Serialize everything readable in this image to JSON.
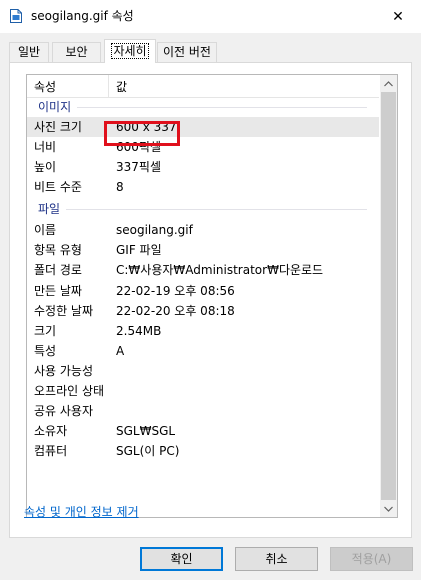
{
  "window": {
    "title": "seogilang.gif 속성",
    "close_glyph": "✕"
  },
  "tabs": [
    {
      "label": "일반",
      "active": false
    },
    {
      "label": "보안",
      "active": false
    },
    {
      "label": "자세히",
      "active": true
    },
    {
      "label": "이전 버전",
      "active": false
    }
  ],
  "table": {
    "headers": {
      "property": "속성",
      "value": "값"
    },
    "groups": {
      "image": "이미지",
      "file": "파일"
    },
    "image_rows": [
      {
        "key": "사진 크기",
        "value": "600 x 337"
      },
      {
        "key": "너비",
        "value": "600픽셀"
      },
      {
        "key": "높이",
        "value": "337픽셀"
      },
      {
        "key": "비트 수준",
        "value": "8"
      }
    ],
    "file_rows": [
      {
        "key": "이름",
        "value": "seogilang.gif"
      },
      {
        "key": "항목 유형",
        "value": "GIF 파일"
      },
      {
        "key": "폴더 경로",
        "value": "C:₩사용자₩Administrator₩다운로드"
      },
      {
        "key": "만든 날짜",
        "value": "22-02-19 오후 08:56"
      },
      {
        "key": "수정한 날짜",
        "value": "22-02-20 오후 08:18"
      },
      {
        "key": "크기",
        "value": "2.54MB"
      },
      {
        "key": "특성",
        "value": "A"
      },
      {
        "key": "사용 가능성",
        "value": ""
      },
      {
        "key": "오프라인 상태",
        "value": ""
      },
      {
        "key": "공유 사용자",
        "value": ""
      },
      {
        "key": "소유자",
        "value": "SGL₩SGL"
      },
      {
        "key": "컴퓨터",
        "value": "SGL(이 PC)"
      }
    ]
  },
  "footer_link": "속성 및 개인 정보 제거",
  "buttons": {
    "ok": "확인",
    "cancel": "취소",
    "apply": "적용(A)"
  },
  "colors": {
    "accent": "#0078d7",
    "highlight": "#e0101c",
    "group_label": "#1e3287"
  }
}
